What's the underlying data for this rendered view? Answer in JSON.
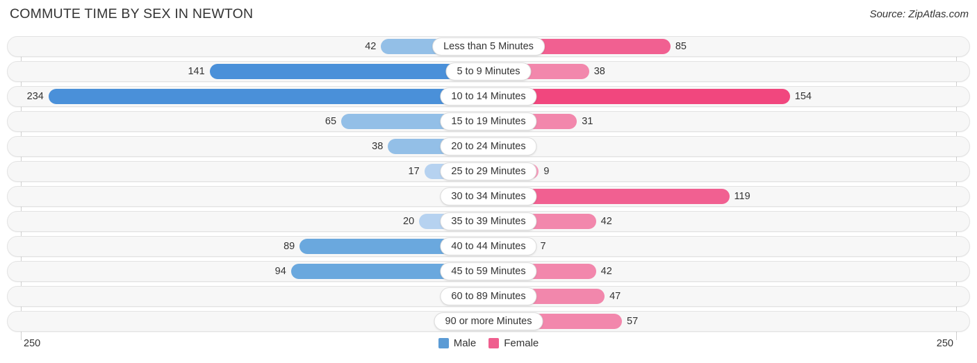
{
  "header": {
    "title": "COMMUTE TIME BY SEX IN NEWTON",
    "source": "Source: ZipAtlas.com"
  },
  "axis": {
    "left_max_label": "250",
    "right_max_label": "250"
  },
  "legend": {
    "items": [
      {
        "label": "Male",
        "color": "#5b9bd5"
      },
      {
        "label": "Female",
        "color": "#ef5e8e"
      }
    ]
  },
  "chart_data": {
    "type": "bar",
    "title": "COMMUTE TIME BY SEX IN NEWTON",
    "subtitle": "Source: ZipAtlas.com",
    "orientation": "horizontal-diverging",
    "xlabel": "",
    "ylabel": "",
    "xlim": [
      250,
      250
    ],
    "axis_max": 250,
    "grid": false,
    "legend_position": "bottom-center",
    "categories": [
      "Less than 5 Minutes",
      "5 to 9 Minutes",
      "10 to 14 Minutes",
      "15 to 19 Minutes",
      "20 to 24 Minutes",
      "25 to 29 Minutes",
      "30 to 34 Minutes",
      "35 to 39 Minutes",
      "40 to 44 Minutes",
      "45 to 59 Minutes",
      "60 to 89 Minutes",
      "90 or more Minutes"
    ],
    "series": [
      {
        "name": "Male",
        "side": "left",
        "color": "#5b9bd5",
        "values": [
          42,
          141,
          234,
          65,
          38,
          17,
          0,
          20,
          89,
          94,
          0,
          0
        ]
      },
      {
        "name": "Female",
        "side": "right",
        "color": "#ef5e8e",
        "values": [
          85,
          38,
          154,
          31,
          0,
          9,
          119,
          42,
          7,
          42,
          47,
          57
        ]
      }
    ]
  },
  "rows": [
    {
      "category": "Less than 5 Minutes",
      "male": "42",
      "female": "85"
    },
    {
      "category": "5 to 9 Minutes",
      "male": "141",
      "female": "38"
    },
    {
      "category": "10 to 14 Minutes",
      "male": "234",
      "female": "154"
    },
    {
      "category": "15 to 19 Minutes",
      "male": "65",
      "female": "31"
    },
    {
      "category": "20 to 24 Minutes",
      "male": "38",
      "female": "0"
    },
    {
      "category": "25 to 29 Minutes",
      "male": "17",
      "female": "9"
    },
    {
      "category": "30 to 34 Minutes",
      "male": "0",
      "female": "119"
    },
    {
      "category": "35 to 39 Minutes",
      "male": "20",
      "female": "42"
    },
    {
      "category": "40 to 44 Minutes",
      "male": "89",
      "female": "7"
    },
    {
      "category": "45 to 59 Minutes",
      "male": "94",
      "female": "42"
    },
    {
      "category": "60 to 89 Minutes",
      "male": "0",
      "female": "47"
    },
    {
      "category": "90 or more Minutes",
      "male": "0",
      "female": "57"
    }
  ]
}
